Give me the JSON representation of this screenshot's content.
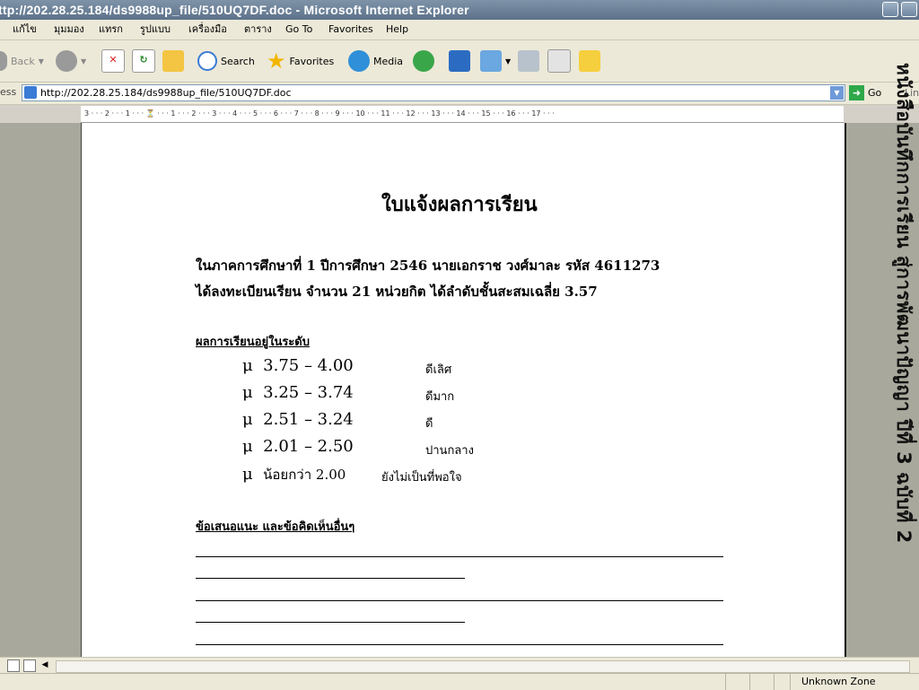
{
  "window": {
    "title": "ttp://202.28.25.184/ds9988up_file/510UQ7DF.doc - Microsoft Internet Explorer"
  },
  "menu": {
    "items": [
      "แก้ไข",
      "มุมมอง",
      "แทรก",
      "รูปแบบ",
      "เครื่องมือ",
      "ตาราง",
      "Go To",
      "Favorites",
      "Help"
    ]
  },
  "toolbar": {
    "back_label": "Back",
    "search_label": "Search",
    "favorites_label": "Favorites",
    "media_label": "Media"
  },
  "address": {
    "label": "ess",
    "url": "http://202.28.25.184/ds9988up_file/510UQ7DF.doc",
    "go_label": "Go",
    "links_label": "Link"
  },
  "ruler": {
    "text": "3 · · · 2 · · · 1 · · · ⏳ · · · 1 · · · 2 · · · 3 · · · 4 · · · 5 · · · 6 · · · 7 · · · 8 · · · 9 · · · 10 · · · 11 · · · 12 · · · 13 · · · 14 · · · 15 · · · 16 · · · 17 · · ·"
  },
  "document": {
    "title": "ใบแจ้งผลการเรียน",
    "line1": "ในภาคการศึกษาที่  1     ปีการศึกษา 2546       นายเอกราช    วงศ์มาละ    รหัส 4611273",
    "line2": "ได้ลงทะเบียนเรียน  จำนวน  21   หน่วยกิต    ได้ลำดับชั้นสะสมเฉลี่ย  3.57",
    "grade_heading": "ผลการเรียนอยู่ในระดับ",
    "grades": [
      {
        "bullet": "μ",
        "range": "3.75 – 4.00",
        "label": "ดีเลิศ"
      },
      {
        "bullet": "μ",
        "range": "3.25 – 3.74",
        "label": "ดีมาก"
      },
      {
        "bullet": "μ",
        "range": "2.51 – 3.24",
        "label": "ดี"
      },
      {
        "bullet": "μ",
        "range": "2.01 – 2.50",
        "label": "ปานกลาง"
      },
      {
        "bullet": "μ",
        "range": "น้อยกว่า 2.00",
        "label": "ยังไม่เป็นที่พอใจ"
      }
    ],
    "suggest_heading": "ข้อเสนอแนะ และข้อคิดเห็นอื่นๆ"
  },
  "side_text": "หนังสือบันทึกการเรียน สู่การพัฒนาปัญญา ปีที่ 3 ฉบับที่ 2",
  "status": {
    "zone": "Unknown Zone"
  }
}
